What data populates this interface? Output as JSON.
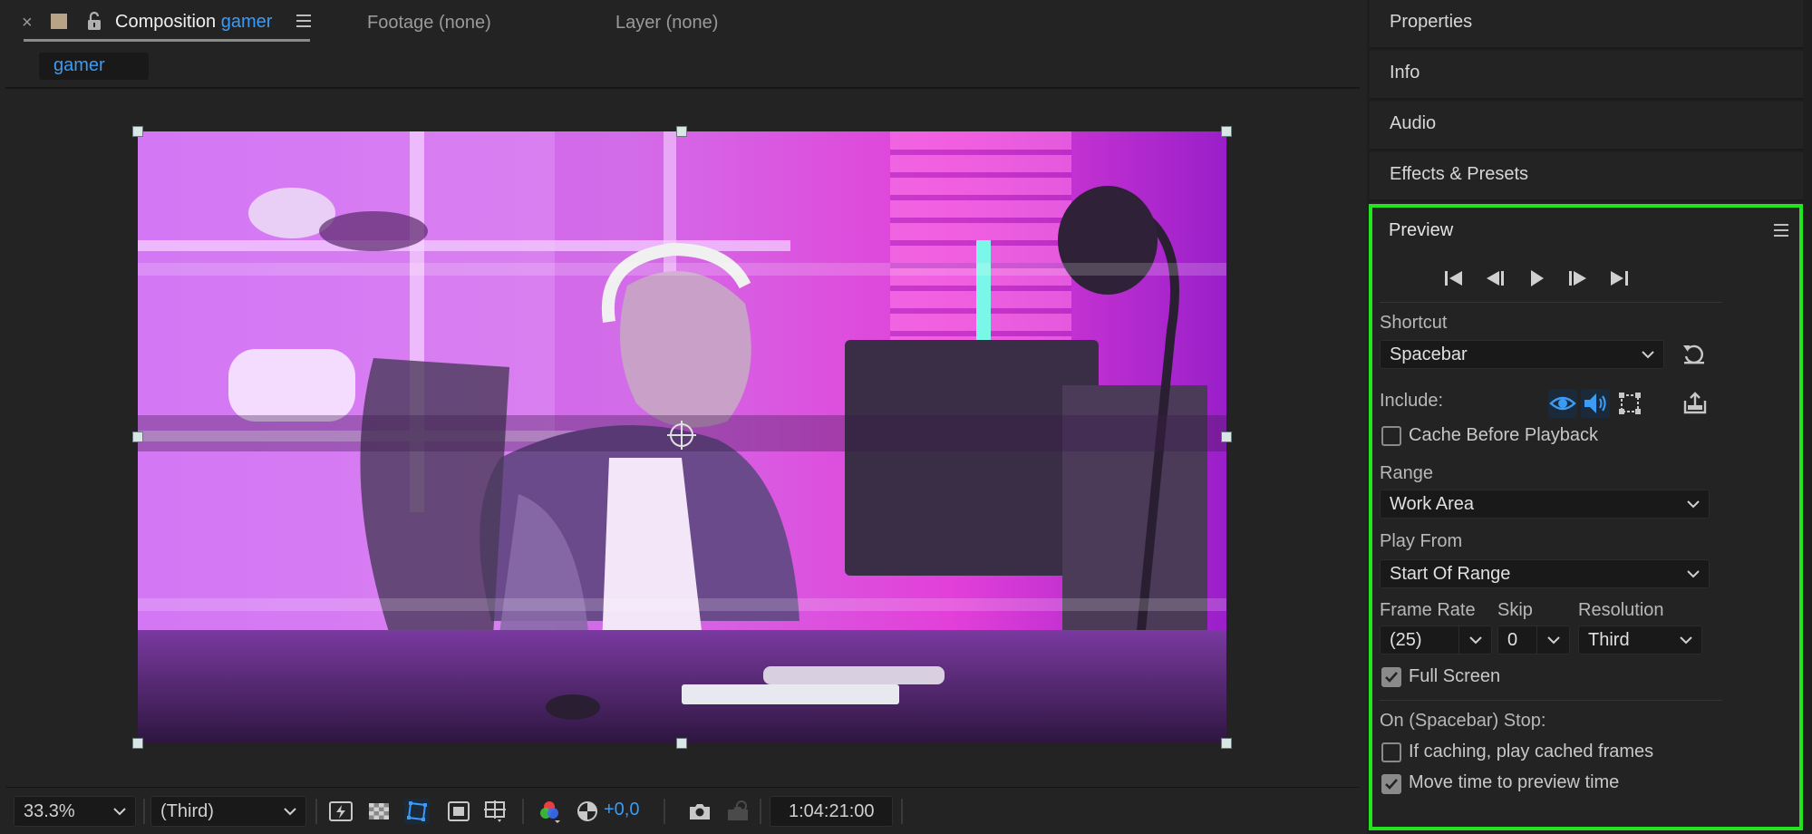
{
  "composition_panel": {
    "close_glyph": "×",
    "tab_prefix": "Composition",
    "tab_name": "gamer",
    "footage_tab": "Footage (none)",
    "layer_tab": "Layer (none)",
    "nav_item": "gamer",
    "label_color": "#b9a386",
    "accent_color": "#3b9bf5"
  },
  "viewer_toolbar": {
    "zoom": "33.3%",
    "resolution": "(Third)",
    "exposure": "+0,0",
    "timecode": "1:04:21:00",
    "icons": [
      "snapshot-fast-preview-icon",
      "transparency-grid-icon",
      "mask-path-icon",
      "region-of-interest-icon",
      "guides-icon",
      "color-channels-icon",
      "reset-exposure-icon",
      "camera-snapshot-icon",
      "show-snapshot-icon"
    ]
  },
  "right_panels": {
    "collapsed": [
      "Properties",
      "Info",
      "Audio",
      "Effects & Presets"
    ]
  },
  "preview": {
    "title": "Preview",
    "shortcut_label": "Shortcut",
    "shortcut_value": "Spacebar",
    "include_label": "Include:",
    "cache_before_playback": "Cache Before Playback",
    "cache_before_playback_checked": false,
    "range_label": "Range",
    "range_value": "Work Area",
    "play_from_label": "Play From",
    "play_from_value": "Start Of Range",
    "frame_rate_label": "Frame Rate",
    "frame_rate_value": "(25)",
    "skip_label": "Skip",
    "skip_value": "0",
    "resolution_label": "Resolution",
    "resolution_value": "Third",
    "full_screen": "Full Screen",
    "full_screen_checked": true,
    "on_stop_label": "On (Spacebar) Stop:",
    "if_caching": "If caching, play cached frames",
    "if_caching_checked": false,
    "move_time": "Move time to preview time",
    "move_time_checked": true,
    "highlight_color": "#22e51e"
  }
}
